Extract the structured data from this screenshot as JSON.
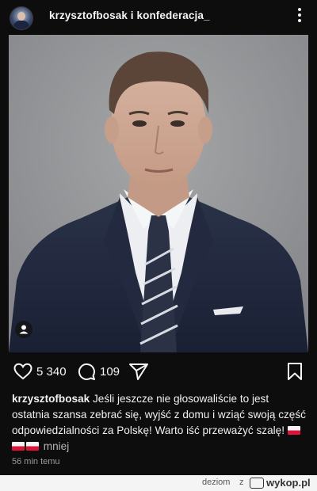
{
  "post": {
    "username": "krzysztofbosak i konfederacja_",
    "likes": "5 340",
    "comments": "109",
    "caption_author": "krzysztofbosak",
    "caption_text": "Jeśli jeszcze nie głosowaliście to jest ostatnia szansa zebrać się, wyjść z domu i wziąć swoją część odpowiedzialności za Polskę! Warto iść przeważyć szalę!",
    "caption_emoji": [
      "flag-poland",
      "flag-poland",
      "flag-poland"
    ],
    "caption_more": "mniej",
    "timestamp": "56 min temu"
  },
  "icons": {
    "avatar": "profile-avatar",
    "more": "more-vertical-icon",
    "tag": "person-tag-icon",
    "like": "heart-icon",
    "comment": "comment-bubble-icon",
    "share": "send-icon",
    "save": "bookmark-icon"
  },
  "footer": {
    "user": "deziom",
    "z": "z",
    "brand": "wykop.pl"
  },
  "colors": {
    "background": "#0d0d0d",
    "text": "#f2f2f2",
    "secondary": "#9a9a9a",
    "footer_bg": "#f4f4f4"
  }
}
